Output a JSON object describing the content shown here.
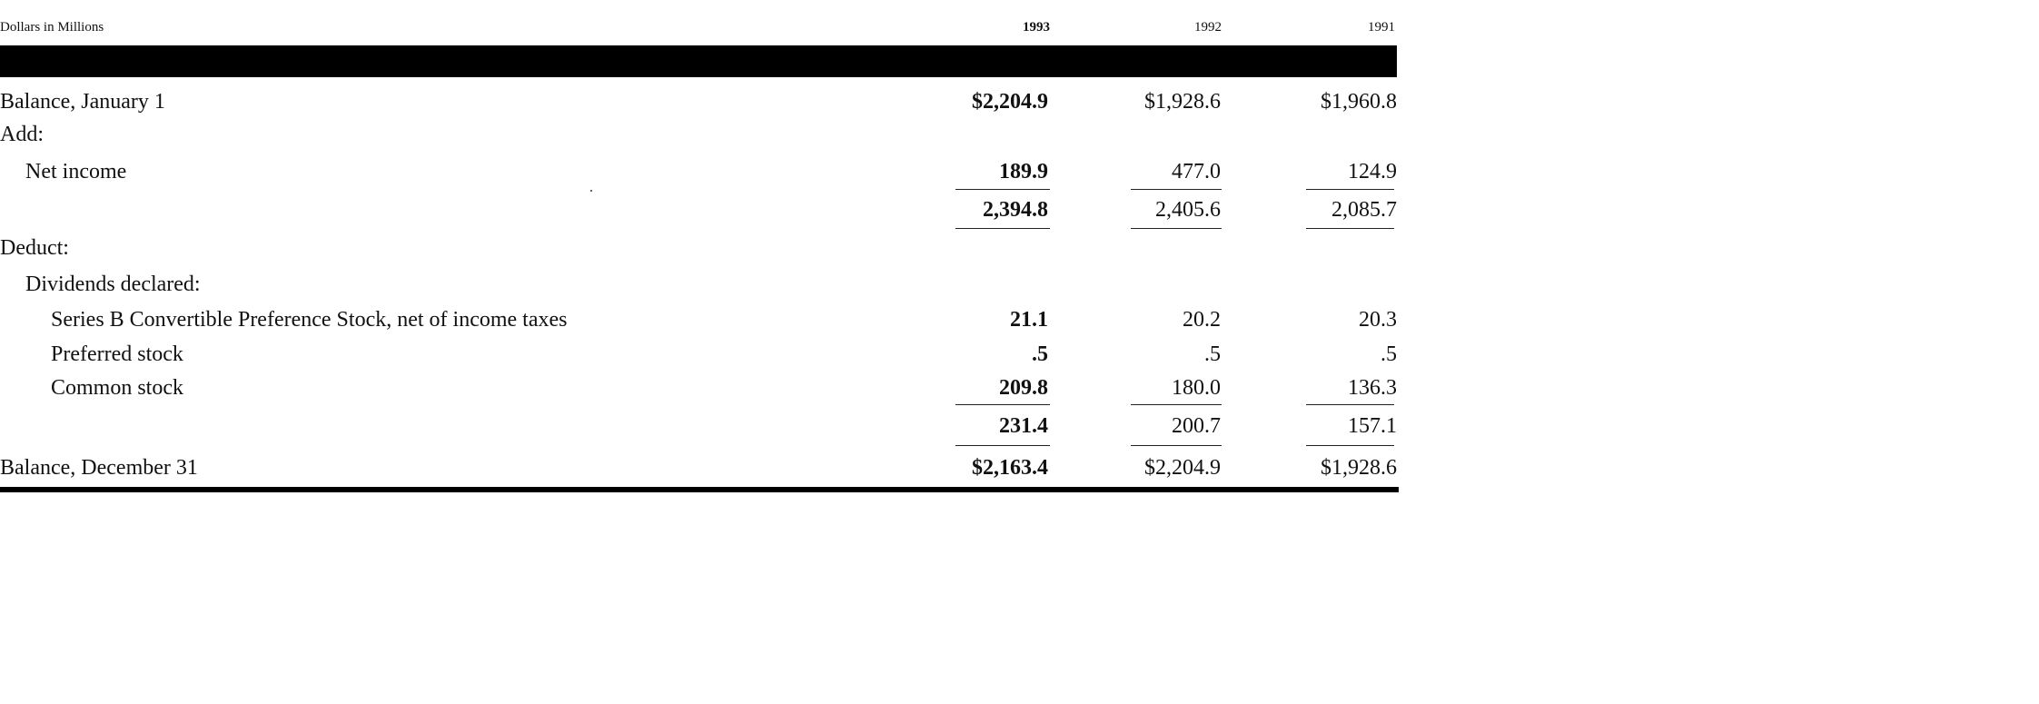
{
  "header": {
    "units_label": "Dollars in Millions",
    "years": [
      "1993",
      "1992",
      "1991"
    ]
  },
  "rows": [
    {
      "label": "Balance, January 1",
      "values": [
        "$2,204.9",
        "$1,928.6",
        "$1,960.8"
      ]
    },
    {
      "label": "Add:",
      "values": [
        "",
        "",
        ""
      ]
    },
    {
      "label": "Net income",
      "values": [
        "189.9",
        "477.0",
        "124.9"
      ]
    },
    {
      "label": "",
      "values": [
        "2,394.8",
        "2,405.6",
        "2,085.7"
      ]
    },
    {
      "label": "Deduct:",
      "values": [
        "",
        "",
        ""
      ]
    },
    {
      "label": "Dividends declared:",
      "values": [
        "",
        "",
        ""
      ]
    },
    {
      "label": "Series B Convertible Preference Stock, net of income taxes",
      "values": [
        "21.1",
        "20.2",
        "20.3"
      ]
    },
    {
      "label": "Preferred stock",
      "values": [
        ".5",
        ".5",
        ".5"
      ]
    },
    {
      "label": "Common stock",
      "values": [
        "209.8",
        "180.0",
        "136.3"
      ]
    },
    {
      "label": "",
      "values": [
        "231.4",
        "200.7",
        "157.1"
      ]
    },
    {
      "label": "Balance, December 31",
      "values": [
        "$2,163.4",
        "$2,204.9",
        "$1,928.6"
      ]
    }
  ]
}
